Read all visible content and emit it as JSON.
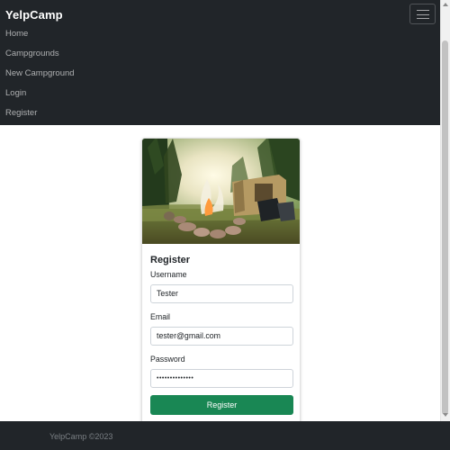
{
  "navbar": {
    "brand": "YelpCamp",
    "links": [
      {
        "label": "Home"
      },
      {
        "label": "Campgrounds"
      },
      {
        "label": "New Campground"
      },
      {
        "label": "Login"
      },
      {
        "label": "Register"
      }
    ]
  },
  "register_card": {
    "title": "Register",
    "username": {
      "label": "Username",
      "value": "Tester"
    },
    "email": {
      "label": "Email",
      "value": "tester@gmail.com"
    },
    "password": {
      "label": "Password",
      "value": "••••••••••••••"
    },
    "submit_label": "Register"
  },
  "footer": {
    "text": "YelpCamp ©2023"
  },
  "colors": {
    "navbar_bg": "#212529",
    "button_bg": "#198754",
    "footer_text": "#7a7f84"
  }
}
